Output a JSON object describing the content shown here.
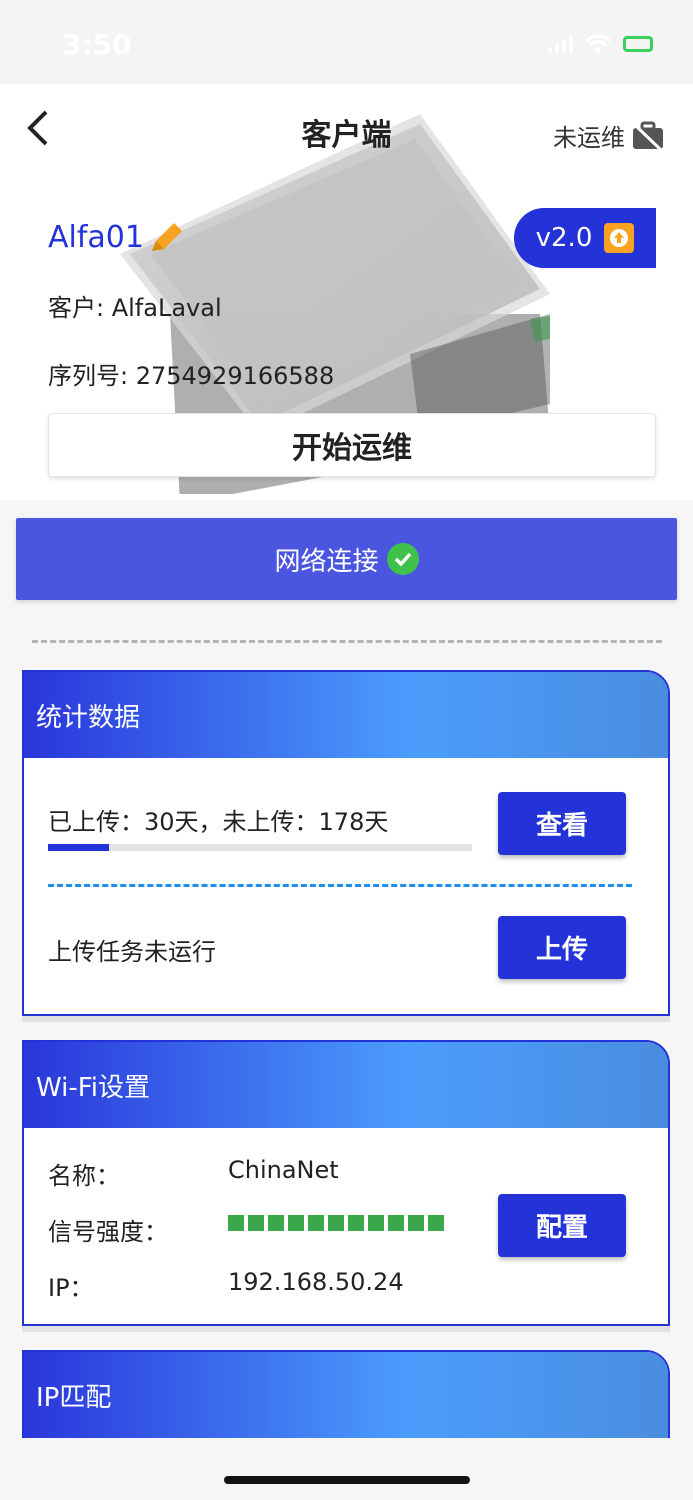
{
  "status_bar": {
    "time": "3:50"
  },
  "header": {
    "title": "客户端",
    "ops_status": "未运维"
  },
  "device": {
    "name": "Alfa01",
    "version": "v2.0",
    "customer_line": "客户: AlfaLaval",
    "serial_line": "序列号: 2754929166588",
    "start_button": "开始运维"
  },
  "network": {
    "label": "网络连接",
    "connected": true
  },
  "stats": {
    "title": "统计数据",
    "summary": "已上传：30天，未上传：178天",
    "progress_fraction": 0.144,
    "view_button": "查看",
    "task_status": "上传任务未运行",
    "upload_button": "上传"
  },
  "wifi": {
    "title": "Wi-Fi设置",
    "name_label": "名称：",
    "name_value": "ChinaNet",
    "signal_label": "信号强度：",
    "signal_level": 11,
    "ip_label": "IP：",
    "ip_value": "192.168.50.24",
    "config_button": "配置"
  },
  "ip_match": {
    "title": "IP匹配"
  },
  "colors": {
    "primary": "#2333d8",
    "accent_orange": "#f7a321",
    "success_green": "#3fc14a"
  }
}
